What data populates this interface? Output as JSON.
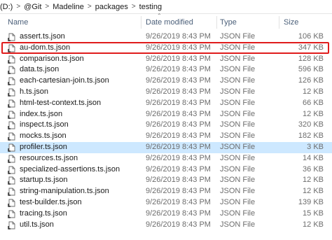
{
  "breadcrumb": [
    "(D:)",
    "@Git",
    "Madeline",
    "packages",
    "testing"
  ],
  "columns": {
    "name": "Name",
    "date": "Date modified",
    "type": "Type",
    "size": "Size"
  },
  "icons": {
    "file": "json-file-icon",
    "sort": "sort-ascending-icon"
  },
  "colors": {
    "highlight": "#e01c1c",
    "selection": "#cde8ff"
  },
  "files": [
    {
      "name": "assert.ts.json",
      "date": "9/26/2019 8:43 PM",
      "type": "JSON File",
      "size": "106 KB"
    },
    {
      "name": "au-dom.ts.json",
      "date": "9/26/2019 8:43 PM",
      "type": "JSON File",
      "size": "347 KB"
    },
    {
      "name": "comparison.ts.json",
      "date": "9/26/2019 8:43 PM",
      "type": "JSON File",
      "size": "128 KB"
    },
    {
      "name": "data.ts.json",
      "date": "9/26/2019 8:43 PM",
      "type": "JSON File",
      "size": "596 KB"
    },
    {
      "name": "each-cartesian-join.ts.json",
      "date": "9/26/2019 8:43 PM",
      "type": "JSON File",
      "size": "126 KB"
    },
    {
      "name": "h.ts.json",
      "date": "9/26/2019 8:43 PM",
      "type": "JSON File",
      "size": "12 KB"
    },
    {
      "name": "html-test-context.ts.json",
      "date": "9/26/2019 8:43 PM",
      "type": "JSON File",
      "size": "66 KB"
    },
    {
      "name": "index.ts.json",
      "date": "9/26/2019 8:43 PM",
      "type": "JSON File",
      "size": "12 KB"
    },
    {
      "name": "inspect.ts.json",
      "date": "9/26/2019 8:43 PM",
      "type": "JSON File",
      "size": "320 KB"
    },
    {
      "name": "mocks.ts.json",
      "date": "9/26/2019 8:43 PM",
      "type": "JSON File",
      "size": "182 KB"
    },
    {
      "name": "profiler.ts.json",
      "date": "9/26/2019 8:43 PM",
      "type": "JSON File",
      "size": "3 KB"
    },
    {
      "name": "resources.ts.json",
      "date": "9/26/2019 8:43 PM",
      "type": "JSON File",
      "size": "14 KB"
    },
    {
      "name": "specialized-assertions.ts.json",
      "date": "9/26/2019 8:43 PM",
      "type": "JSON File",
      "size": "36 KB"
    },
    {
      "name": "startup.ts.json",
      "date": "9/26/2019 8:43 PM",
      "type": "JSON File",
      "size": "12 KB"
    },
    {
      "name": "string-manipulation.ts.json",
      "date": "9/26/2019 8:43 PM",
      "type": "JSON File",
      "size": "12 KB"
    },
    {
      "name": "test-builder.ts.json",
      "date": "9/26/2019 8:43 PM",
      "type": "JSON File",
      "size": "139 KB"
    },
    {
      "name": "tracing.ts.json",
      "date": "9/26/2019 8:43 PM",
      "type": "JSON File",
      "size": "15 KB"
    },
    {
      "name": "util.ts.json",
      "date": "9/26/2019 8:43 PM",
      "type": "JSON File",
      "size": "12 KB"
    }
  ],
  "selected_index": 10
}
